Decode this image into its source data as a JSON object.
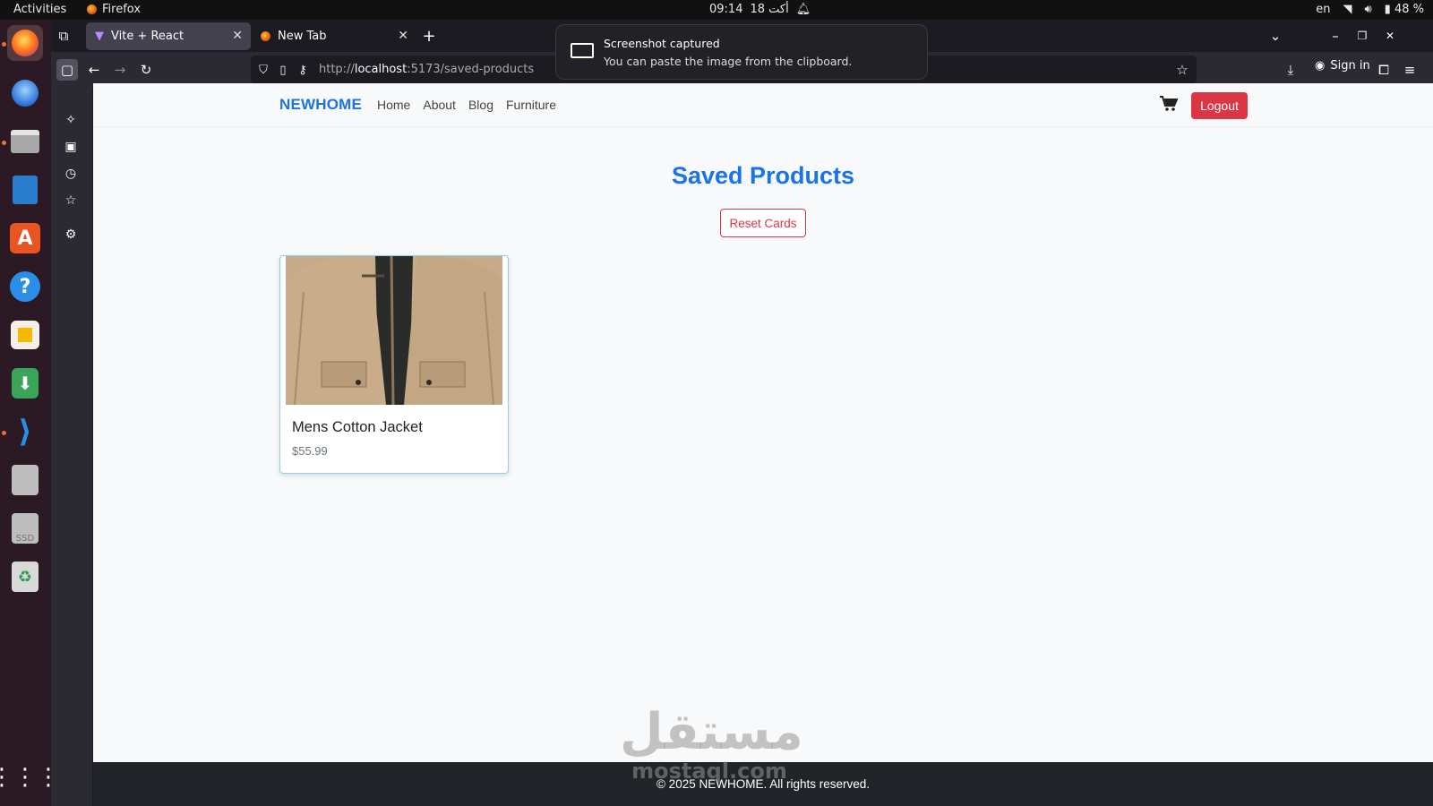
{
  "system": {
    "activities": "Activities",
    "app_name": "Firefox",
    "clock_time": "09:14",
    "clock_date": "18 أكت",
    "lang": "en",
    "battery": "48 %"
  },
  "browser": {
    "tabs": [
      {
        "label": "Vite + React",
        "active": true
      },
      {
        "label": "New Tab",
        "active": false
      }
    ],
    "url_prefix": "http://",
    "url_host": "localhost",
    "url_path": ":5173/saved-products",
    "sign_in": "Sign in"
  },
  "notification": {
    "title": "Screenshot captured",
    "body": "You can paste the image from the clipboard."
  },
  "site": {
    "brand": "NEWHOME",
    "nav": [
      "Home",
      "About",
      "Blog",
      "Furniture"
    ],
    "logout": "Logout",
    "page_title": "Saved Products",
    "reset_button": "Reset Cards",
    "products": [
      {
        "name": "Mens Cotton Jacket",
        "price": "$55.99"
      }
    ],
    "footer": "© 2025 NEWHOME. All rights reserved."
  },
  "watermark": {
    "arabic": "مستقل",
    "latin": "mostaql.com"
  },
  "colors": {
    "brand": "#1a73e8",
    "danger": "#dc3545",
    "footer_bg": "#212529",
    "card_border": "#8fd3df"
  }
}
